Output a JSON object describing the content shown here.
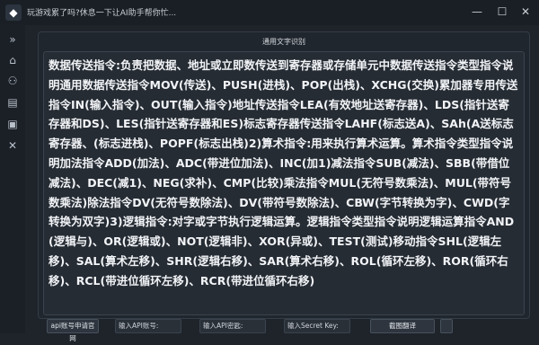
{
  "window": {
    "title": "玩游戏累了吗?休息一下让AI助手帮你忙..."
  },
  "panel": {
    "title": "通用文字识别",
    "text": "数据传送指令:负责把数据、地址或立即数传送到寄存器或存储单元中数据传送指令类型指令说明通用数据传送指令MOV(传送)、PUSH(进栈)、POP(出栈)、XCHG(交换)累加器专用传送指令IN(输入指令)、OUT(输入指令)地址传送指令LEA(有效地址送寄存器)、LDS(指针送寄存器和DS)、LES(指针送寄存器和ES)标志寄存器传送指令LAHF(标志送A)、SAh(A送标志寄存器、(标志进栈)、POPF(标志出栈)2)算术指令:用来执行算术运算。算术指令类型指令说明加法指令ADD(加法)、ADC(带进位加法)、INC(加1)减法指令SUB(减法)、SBB(带借位减法)、DEC(减1)、NEG(求补)、CMP(比较)乘法指令MUL(无符号数乘法)、MUL(带符号数乘法)除法指令DV(无符号数除法)、DV(带符号数除法)、CBW(字节转换为字)、CWD(字转换为双字)3)逻辑指令:对字或字节执行逻辑运算。逻辑指令类型指令说明逻辑运算指令AND(逻辑与)、OR(逻辑或)、NOT(逻辑非)、XOR(异或)、TEST(测试)移动指令SHL(逻辑左移)、SAL(算术左移)、SHR(逻辑右移)、SAR(算术右移)、ROL(循环左移)、ROR(循环右移)、RCL(带进位循环左移)、RCR(带进位循环右移)"
  },
  "sidebar": {
    "icons": [
      "expand-icon",
      "home-icon",
      "game-icon",
      "document-icon",
      "file-icon",
      "close-icon"
    ]
  },
  "bottom": {
    "api_link_label": "api账号申请官网",
    "api_key_placeholder": "输入API账号:",
    "api_secret_placeholder": "输入API密匙:",
    "secret_key_placeholder": "输入Secret Key:",
    "translate_label": "截图翻译"
  },
  "colors": {
    "background": "#1f242b",
    "text": "#f2f4f7",
    "border": "#343c46"
  }
}
